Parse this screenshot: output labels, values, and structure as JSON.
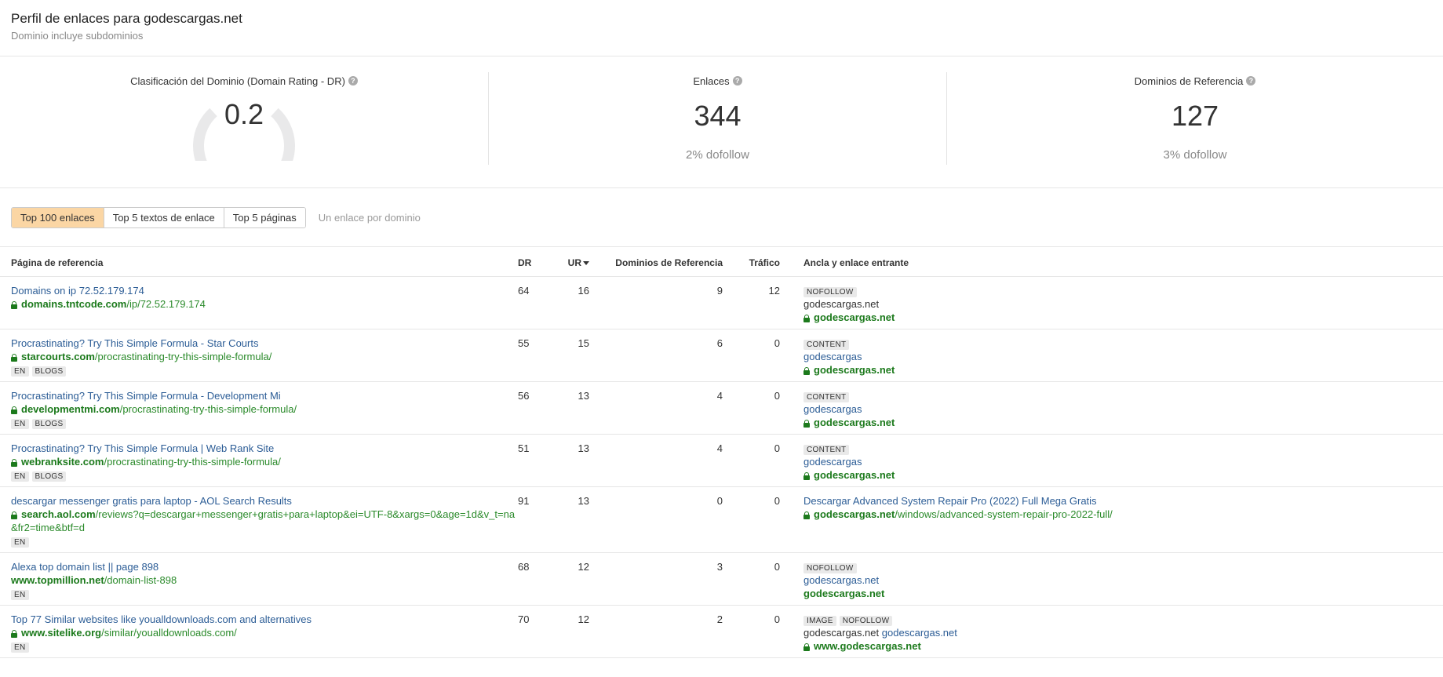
{
  "header": {
    "title": "Perfil de enlaces para godescargas.net",
    "subtitle": "Dominio incluye subdominios"
  },
  "metrics": {
    "dr": {
      "label": "Clasificación del Dominio (Domain Rating - DR)",
      "value": "0.2",
      "gauge_fraction": 0.002
    },
    "links": {
      "label": "Enlaces",
      "value": "344",
      "note": "2% dofollow"
    },
    "refdomains": {
      "label": "Dominios de Referencia",
      "value": "127",
      "note": "3% dofollow"
    }
  },
  "tabs": {
    "items": [
      "Top 100 enlaces",
      "Top 5 textos de enlace",
      "Top 5 páginas"
    ],
    "active": 0,
    "option": "Un enlace por dominio"
  },
  "table": {
    "headers": {
      "page": "Página de referencia",
      "dr": "DR",
      "ur": "UR",
      "refdomains": "Dominios de Referencia",
      "traffic": "Tráfico",
      "anchor": "Ancla y enlace entrante"
    },
    "rows": [
      {
        "title": "Domains on ip 72.52.179.174",
        "lock": true,
        "domain": "domains.tntcode.com",
        "path": "/ip/72.52.179.174",
        "tags": [],
        "dr": "64",
        "ur": "16",
        "refdomains": "9",
        "traffic": "12",
        "anchor_tags": [
          "NOFOLLOW"
        ],
        "anchor_text": "godescargas.net",
        "anchor_linked": false,
        "anchor_extra": "",
        "target_lock": true,
        "target_domain": "godescargas.net",
        "target_path": ""
      },
      {
        "title": "Procrastinating? Try This Simple Formula - Star Courts",
        "lock": true,
        "domain": "starcourts.com",
        "path": "/procrastinating-try-this-simple-formula/",
        "tags": [
          "EN",
          "BLOGS"
        ],
        "dr": "55",
        "ur": "15",
        "refdomains": "6",
        "traffic": "0",
        "anchor_tags": [
          "CONTENT"
        ],
        "anchor_text": "godescargas",
        "anchor_linked": true,
        "anchor_extra": "",
        "target_lock": true,
        "target_domain": "godescargas.net",
        "target_path": ""
      },
      {
        "title": "Procrastinating? Try This Simple Formula - Development Mi",
        "lock": true,
        "domain": "developmentmi.com",
        "path": "/procrastinating-try-this-simple-formula/",
        "tags": [
          "EN",
          "BLOGS"
        ],
        "dr": "56",
        "ur": "13",
        "refdomains": "4",
        "traffic": "0",
        "anchor_tags": [
          "CONTENT"
        ],
        "anchor_text": "godescargas",
        "anchor_linked": true,
        "anchor_extra": "",
        "target_lock": true,
        "target_domain": "godescargas.net",
        "target_path": ""
      },
      {
        "title": "Procrastinating? Try This Simple Formula | Web Rank Site",
        "lock": true,
        "domain": "webranksite.com",
        "path": "/procrastinating-try-this-simple-formula/",
        "tags": [
          "EN",
          "BLOGS"
        ],
        "dr": "51",
        "ur": "13",
        "refdomains": "4",
        "traffic": "0",
        "anchor_tags": [
          "CONTENT"
        ],
        "anchor_text": "godescargas",
        "anchor_linked": true,
        "anchor_extra": "",
        "target_lock": true,
        "target_domain": "godescargas.net",
        "target_path": ""
      },
      {
        "title": "descargar messenger gratis para laptop - AOL Search Results",
        "lock": true,
        "domain": "search.aol.com",
        "path": "/reviews?q=descargar+messenger+gratis+para+laptop&ei=UTF-8&xargs=0&age=1d&v_t=na&fr2=time&btf=d",
        "tags": [
          "EN"
        ],
        "dr": "91",
        "ur": "13",
        "refdomains": "0",
        "traffic": "0",
        "anchor_tags": [],
        "anchor_text": "Descargar Advanced System Repair Pro (2022) Full Mega Gratis",
        "anchor_linked": true,
        "anchor_extra": "",
        "target_lock": true,
        "target_domain": "godescargas.net",
        "target_path": "/windows/advanced-system-repair-pro-2022-full/"
      },
      {
        "title": "Alexa top domain list || page 898",
        "lock": false,
        "domain": "www.topmillion.net",
        "path": "/domain-list-898",
        "tags": [
          "EN"
        ],
        "dr": "68",
        "ur": "12",
        "refdomains": "3",
        "traffic": "0",
        "anchor_tags": [
          "NOFOLLOW"
        ],
        "anchor_text": "godescargas.net",
        "anchor_linked": true,
        "anchor_extra": "",
        "target_lock": false,
        "target_domain": "godescargas.net",
        "target_path": ""
      },
      {
        "title": "Top 77 Similar websites like youalldownloads.com and alternatives",
        "lock": true,
        "domain": "www.sitelike.org",
        "path": "/similar/youalldownloads.com/",
        "tags": [
          "EN"
        ],
        "dr": "70",
        "ur": "12",
        "refdomains": "2",
        "traffic": "0",
        "anchor_tags": [
          "IMAGE",
          "NOFOLLOW"
        ],
        "anchor_text": "godescargas.net",
        "anchor_linked": false,
        "anchor_extra": "godescargas.net",
        "target_lock": true,
        "target_domain": "www.godescargas.net",
        "target_path": ""
      }
    ]
  }
}
